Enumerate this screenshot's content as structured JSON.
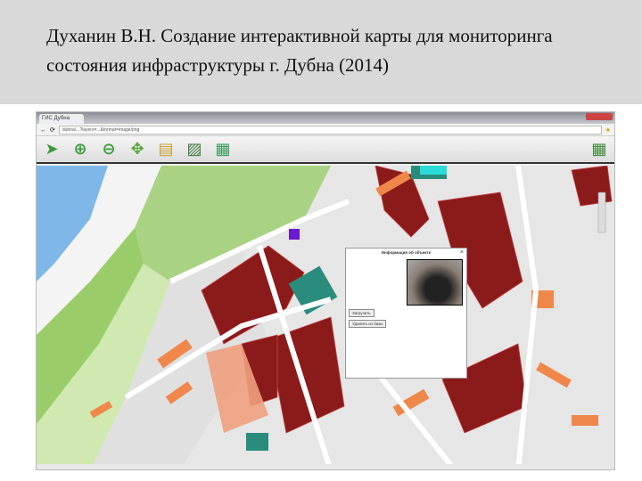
{
  "slide": {
    "title": "Духанин В.Н. Создание интерактивной карты для мониторинга состояния инфраструктуры г. Дубна (2014)"
  },
  "browser": {
    "tab_label": "ГИС Дубна",
    "url": "dubna/...?layers=...&format=image/png"
  },
  "toolbar": {
    "tools": [
      {
        "icon": "select-arrow-icon",
        "glyph": "➤",
        "color": "#3a9a3a"
      },
      {
        "icon": "zoom-in-icon",
        "glyph": "⊕",
        "color": "#3a9a3a"
      },
      {
        "icon": "zoom-out-icon",
        "glyph": "⊖",
        "color": "#3a9a3a"
      },
      {
        "icon": "pan-icon",
        "glyph": "✥",
        "color": "#5aa53a"
      },
      {
        "icon": "notes-icon",
        "glyph": "▤",
        "color": "#c8a030"
      },
      {
        "icon": "image-layer-icon",
        "glyph": "▨",
        "color": "#3c7c3c"
      },
      {
        "icon": "grid-layer-icon",
        "glyph": "▦",
        "color": "#3a9a5a"
      }
    ]
  },
  "popup": {
    "title": "Информация об объекте",
    "button_load": "Загрузить",
    "button_delete": "Удалить из базы",
    "close": "×"
  },
  "colors": {
    "building": "#8b1a1a",
    "house": "#f0874a",
    "teal": "#2a8c7c",
    "park": "#9acd6a",
    "water": "#7fb8e8",
    "road": "#f4f4f4"
  }
}
